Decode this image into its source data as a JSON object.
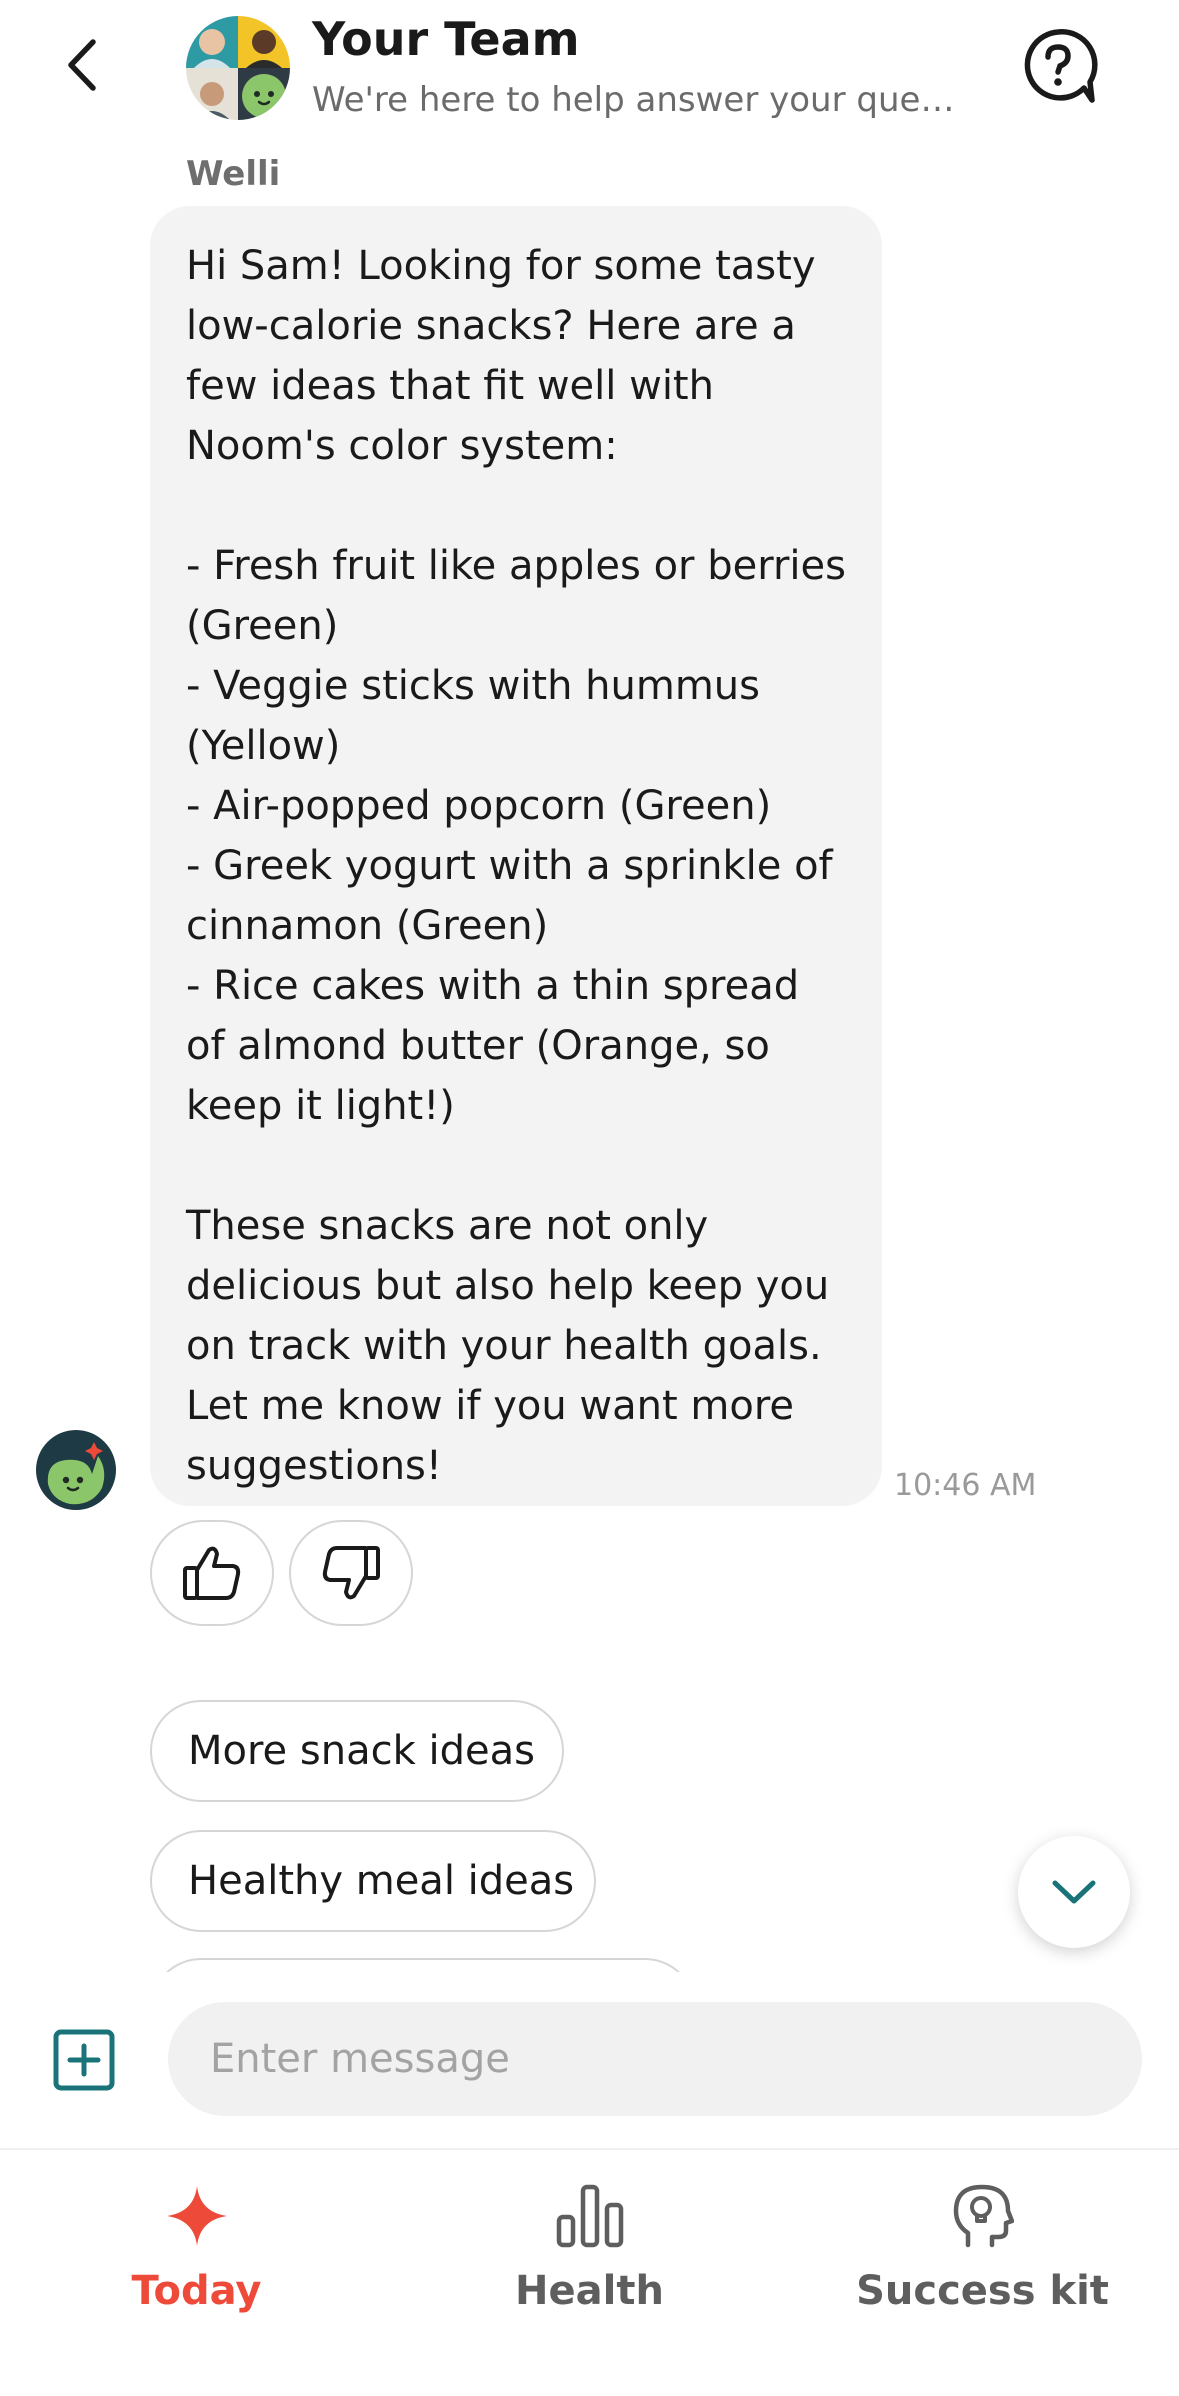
{
  "header": {
    "title": "Your Team",
    "subtitle": "We're here to help answer your questi…",
    "back_icon": "chevron-left-icon",
    "help_icon": "question-bubble-icon"
  },
  "conversation": {
    "sender": "Welli",
    "message": "Hi Sam! Looking for some tasty low-calorie snacks? Here are a few ideas that fit well with Noom's color system:\n\n- Fresh fruit like apples or berries (Green)\n- Veggie sticks with hummus (Yellow)\n- Air-popped popcorn (Green)\n- Greek yogurt with a sprinkle of cinnamon (Green)\n- Rice cakes with a thin spread of almond butter (Orange, so keep it light!)\n\nThese snacks are not only delicious but also help keep you on track with your health goals. Let me know if you want more suggestions!",
    "timestamp": "10:46 AM",
    "reactions": [
      "thumbs-up-icon",
      "thumbs-down-icon"
    ]
  },
  "suggestions": [
    "More snack ideas",
    "Healthy meal ideas",
    ""
  ],
  "composer": {
    "placeholder": "Enter message",
    "add_icon": "plus-square-icon"
  },
  "nav": {
    "items": [
      {
        "label": "Today",
        "icon": "sparkle-icon",
        "active": true
      },
      {
        "label": "Health",
        "icon": "bar-chart-icon",
        "active": false
      },
      {
        "label": "Success kit",
        "icon": "head-lightbulb-icon",
        "active": false
      }
    ]
  },
  "colors": {
    "accent": "#ee4a3a",
    "teal": "#1a7378",
    "bubble": "#f3f3f3",
    "muted_text": "#6b6b6b",
    "nav_inactive": "#5e5e5e"
  }
}
